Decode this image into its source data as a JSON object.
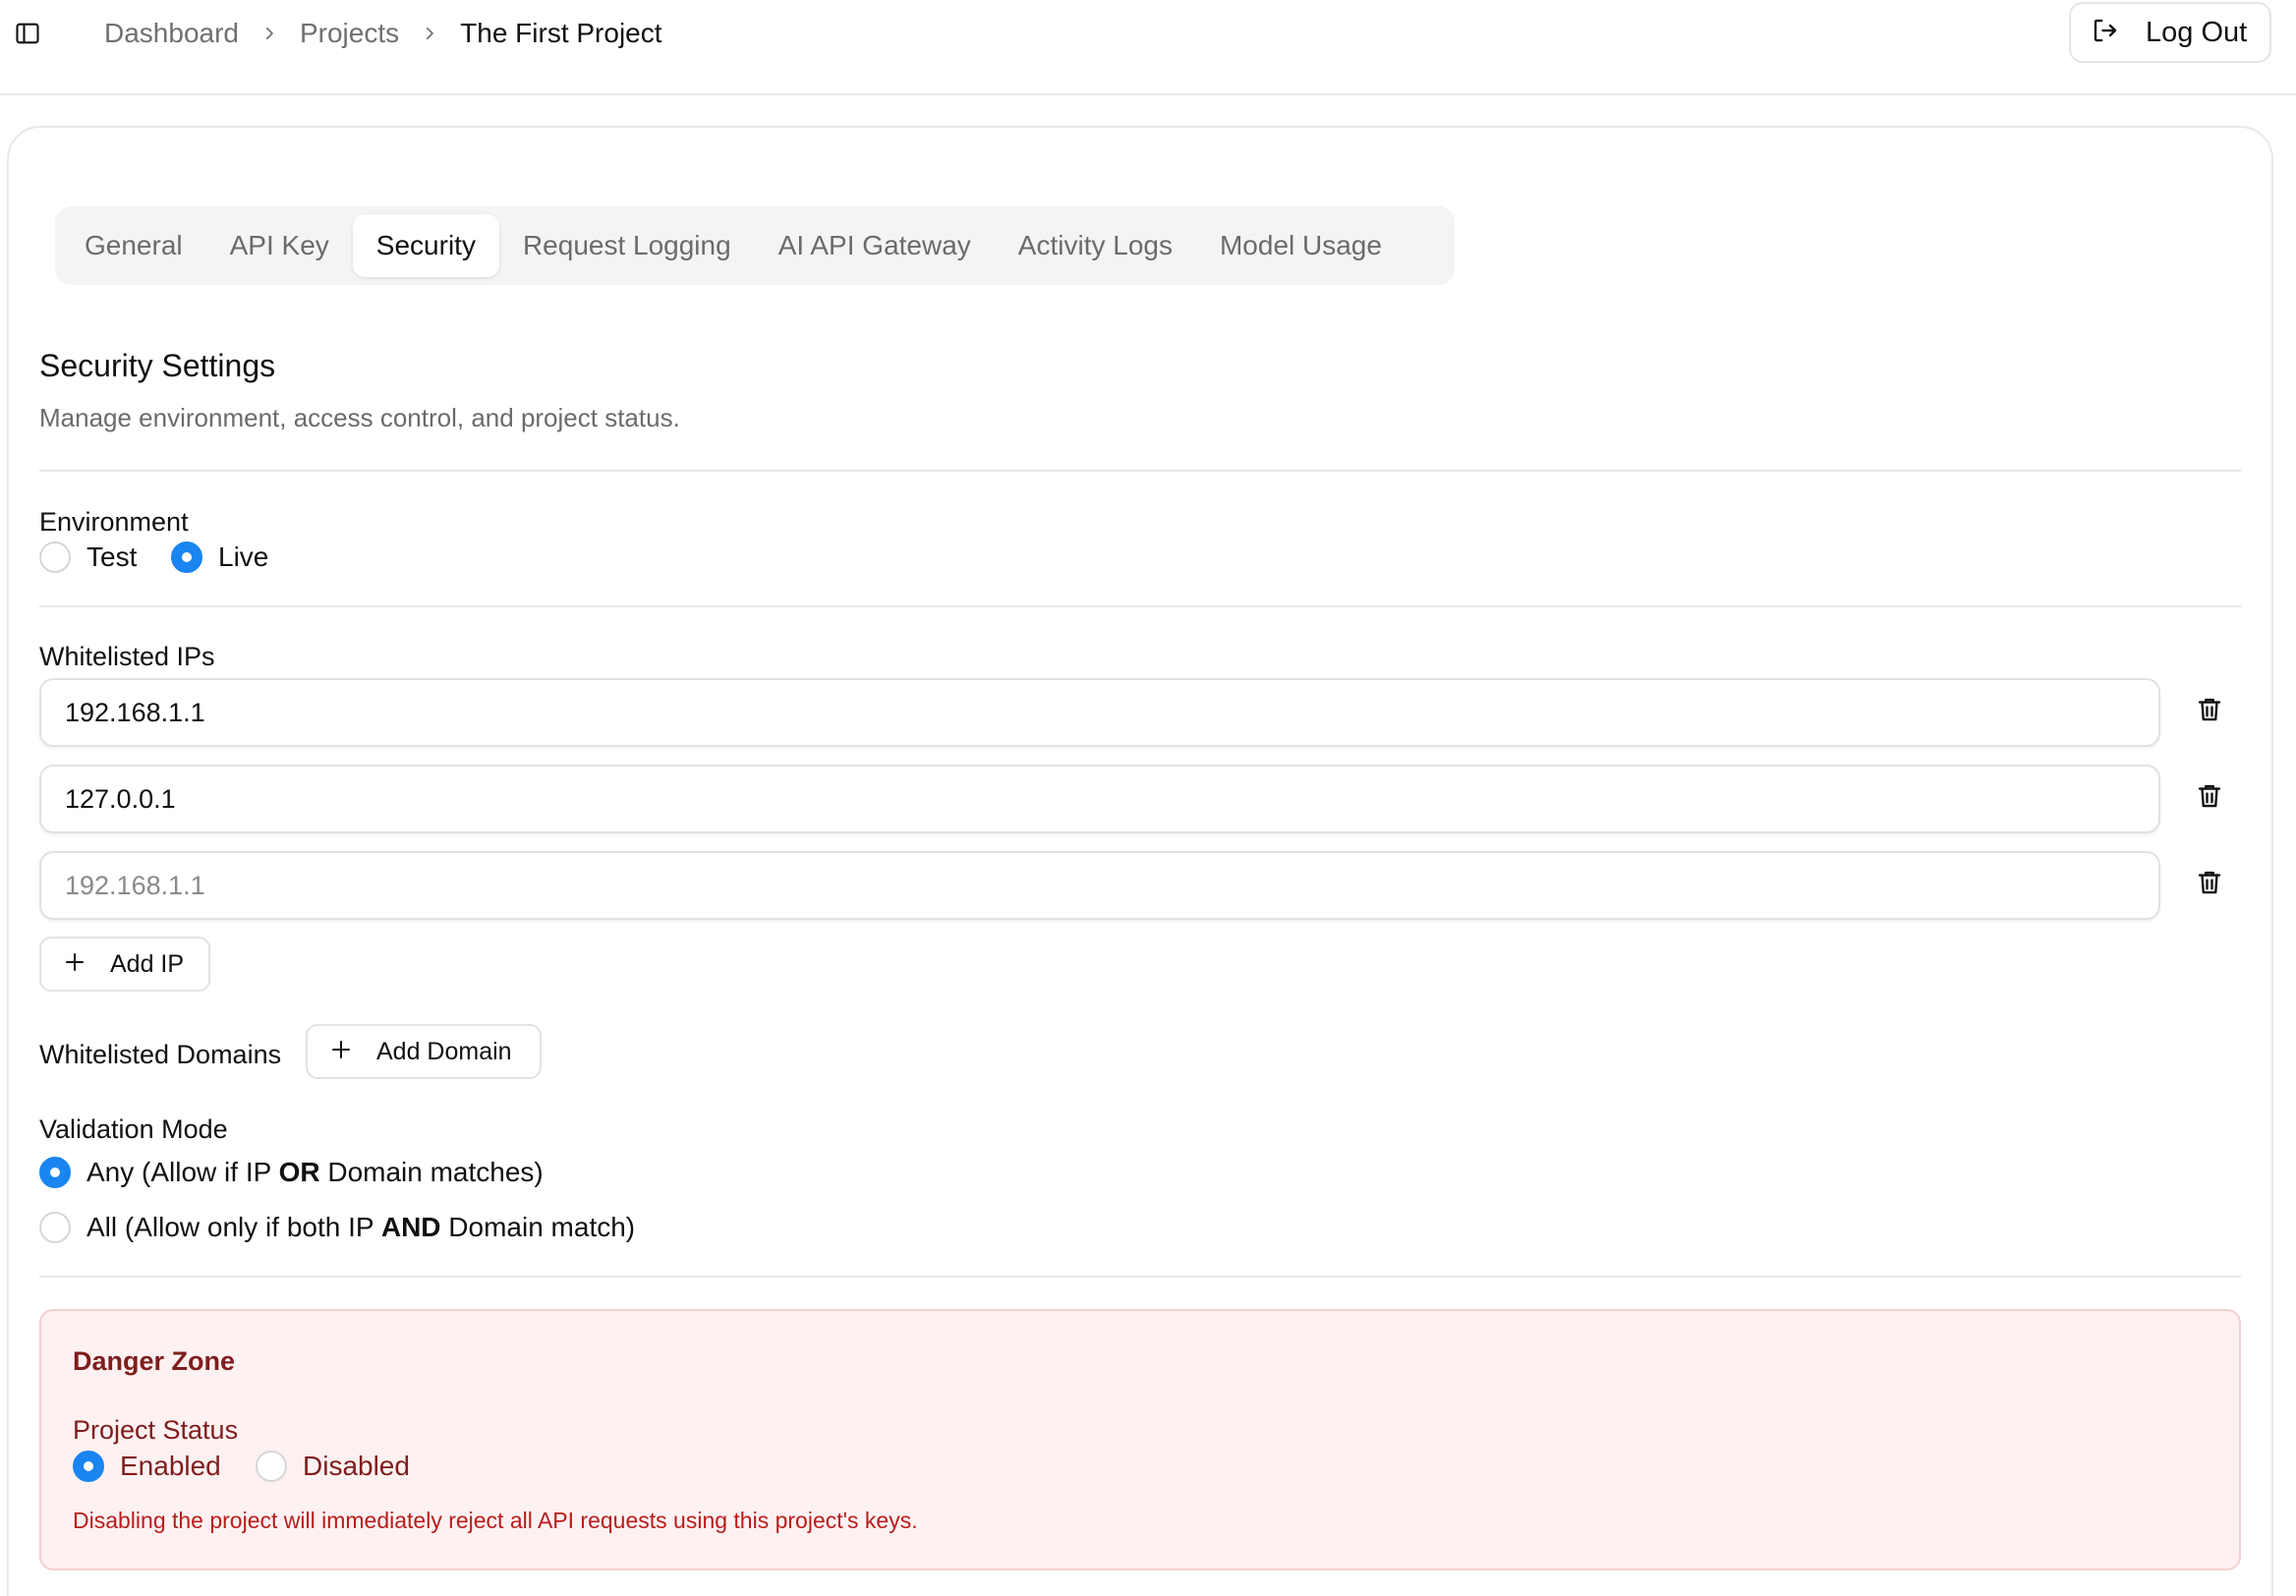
{
  "breadcrumb": {
    "items": [
      "Dashboard",
      "Projects",
      "The First Project"
    ]
  },
  "header": {
    "logout_label": "Log Out"
  },
  "tabs": [
    {
      "label": "General"
    },
    {
      "label": "API Key"
    },
    {
      "label": "Security",
      "active": true
    },
    {
      "label": "Request Logging"
    },
    {
      "label": "AI API Gateway"
    },
    {
      "label": "Activity Logs"
    },
    {
      "label": "Model Usage"
    }
  ],
  "security": {
    "title": "Security Settings",
    "description": "Manage environment, access control, and project status."
  },
  "environment": {
    "label": "Environment",
    "options": [
      {
        "label": "Test",
        "selected": false
      },
      {
        "label": "Live",
        "selected": true
      }
    ]
  },
  "whitelisted_ips": {
    "label": "Whitelisted IPs",
    "entries": [
      {
        "value": "192.168.1.1",
        "placeholder": ""
      },
      {
        "value": "127.0.0.1",
        "placeholder": ""
      },
      {
        "value": "",
        "placeholder": "192.168.1.1"
      }
    ],
    "add_label": "Add IP"
  },
  "whitelisted_domains": {
    "label": "Whitelisted Domains",
    "add_label": "Add Domain"
  },
  "validation_mode": {
    "label": "Validation Mode",
    "options": [
      {
        "prefix": "Any (Allow if IP ",
        "strong": "OR",
        "suffix": " Domain matches)",
        "selected": true
      },
      {
        "prefix": "All (Allow only if both IP ",
        "strong": "AND",
        "suffix": " Domain match)",
        "selected": false
      }
    ]
  },
  "danger_zone": {
    "title": "Danger Zone",
    "status_label": "Project Status",
    "options": [
      {
        "label": "Enabled",
        "selected": true
      },
      {
        "label": "Disabled",
        "selected": false
      }
    ],
    "note": "Disabling the project will immediately reject all API requests using this project's keys."
  },
  "colors": {
    "accent": "#1a84f0",
    "danger_bg": "#fef1f1",
    "danger_text": "#7f1d1d",
    "danger_note": "#b91c1c"
  },
  "icons": {
    "sidebar_toggle": "sidebar-panel-icon",
    "breadcrumb_separator": "chevron-right-icon",
    "logout": "logout-icon",
    "delete": "trash-icon",
    "add": "plus-icon"
  }
}
